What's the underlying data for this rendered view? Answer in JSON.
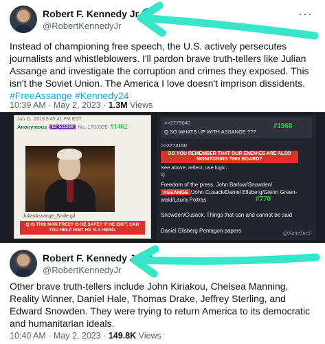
{
  "tweet1": {
    "name": "Robert F. Kennedy Jr",
    "handle": "@RobertKennedyJr",
    "text": "Instead of championing free speech, the U.S. actively persecutes journalists and whistleblowers. I'll pardon brave truth-tellers like Julian Assange and investigate the corruption and crimes they exposed. This isn't the Soviet Union. The America I love doesn't imprison dissidents.",
    "hashtags": "#FreeAssange #Kennedy24",
    "time": "10:39 AM · May 2, 2023 · ",
    "views_count": "1.3M",
    "views_label": " Views"
  },
  "collage": {
    "left": {
      "date": "Jun 11, 2018 5:45:41 PM EDT",
      "anon": "Anonymous",
      "id": "ID: 511266",
      "no": "No. 1703935",
      "badge": "#1462",
      "filename": "JulianAssange_Smile.gif",
      "question": "Q IS THIS MAN FREE? IS HE SAFE? IF HE ISN'T, CAN YOU HELP HIM? HE IS A HERO."
    },
    "right": {
      "ref1": ">>2773040",
      "q1": "Q SO WHATS UP WITH ASSANGE ???",
      "badge1": "#1968",
      "ref2": ">>2773150",
      "highlight": "DO YOU REMEMBER THAT OUR ENEMIES ARE ALSO MONITORING THIS BOARD?",
      "line1": "See above, reflect, use logic.",
      "line2": "Q",
      "free_press_1": "Freedom of the press. John Barlow/Snowden/",
      "assange_tag": "ASSANGE",
      "free_press_2": "/John Cusack/Daniel Ellsberg/Glenn Green-",
      "free_press_3": "wald/Laura Poitras",
      "badge2": "#770",
      "line3": "Snowden/Cusack. Things that can and cannot be said",
      "line4": "Daniel Ellsberg Pentagon papers",
      "watermark": "@KatieSue3"
    }
  },
  "tweet2": {
    "name": "Robert F. Kennedy Jr",
    "handle": "@RobertKennedyJr",
    "text": "Other brave truth-tellers include John Kiriakou, Chelsea Manning, Reality Winner, Daniel Hale, Thomas Drake, Jeffrey Sterling, and Edward Snowden. They were trying to return America to its democratic and humanitarian ideals.",
    "time": "10:40 AM · May 2, 2023 · ",
    "views_count": "149.8K",
    "views_label": " Views"
  },
  "icons": {
    "verified": "verified-badge-icon",
    "more": "more-options-icon",
    "arrow": "annotation-arrow"
  },
  "colors": {
    "link": "#1d9bf0",
    "arrow": "#35e6c8",
    "q_red": "#d8342c",
    "badge_green": "#25d14a"
  }
}
